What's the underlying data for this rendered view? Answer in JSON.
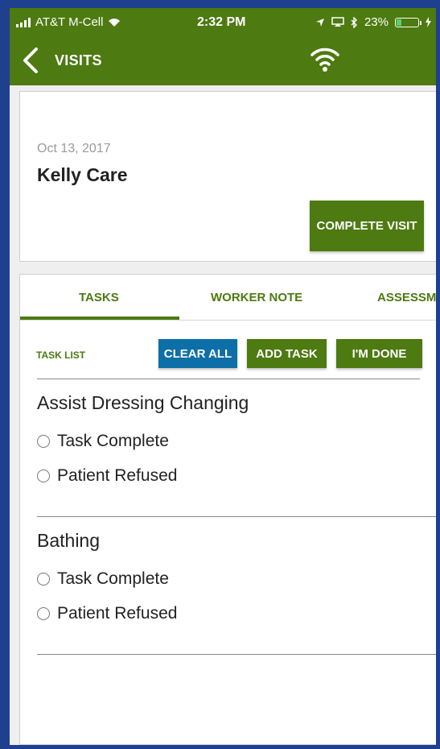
{
  "status_bar": {
    "carrier": "AT&T M-Cell",
    "time": "2:32 PM",
    "battery": "23%",
    "battery_level": 0.23
  },
  "nav": {
    "back_icon": "chevron-left-icon",
    "title": "VISITS",
    "wifi_icon": "wifi-icon"
  },
  "visit": {
    "date": "Oct 13, 2017",
    "patient": "Kelly Care",
    "complete_label": "COMPLETE VISIT"
  },
  "tabs": [
    {
      "label": "TASKS",
      "active": true
    },
    {
      "label": "WORKER NOTE",
      "active": false
    },
    {
      "label": "ASSESSM",
      "active": false
    }
  ],
  "task_panel": {
    "list_label": "TASK LIST",
    "clear_all": "CLEAR ALL",
    "add_task": "ADD TASK",
    "im_done": "I'M DONE"
  },
  "tasks": [
    {
      "title": "Assist Dressing Changing",
      "options": [
        "Task Complete",
        "Patient Refused"
      ]
    },
    {
      "title": "Bathing",
      "options": [
        "Task Complete",
        "Patient Refused"
      ]
    }
  ],
  "colors": {
    "brand_green": "#4d7a11",
    "action_blue": "#0d6fa8",
    "frame_blue": "#1f3f8f"
  }
}
